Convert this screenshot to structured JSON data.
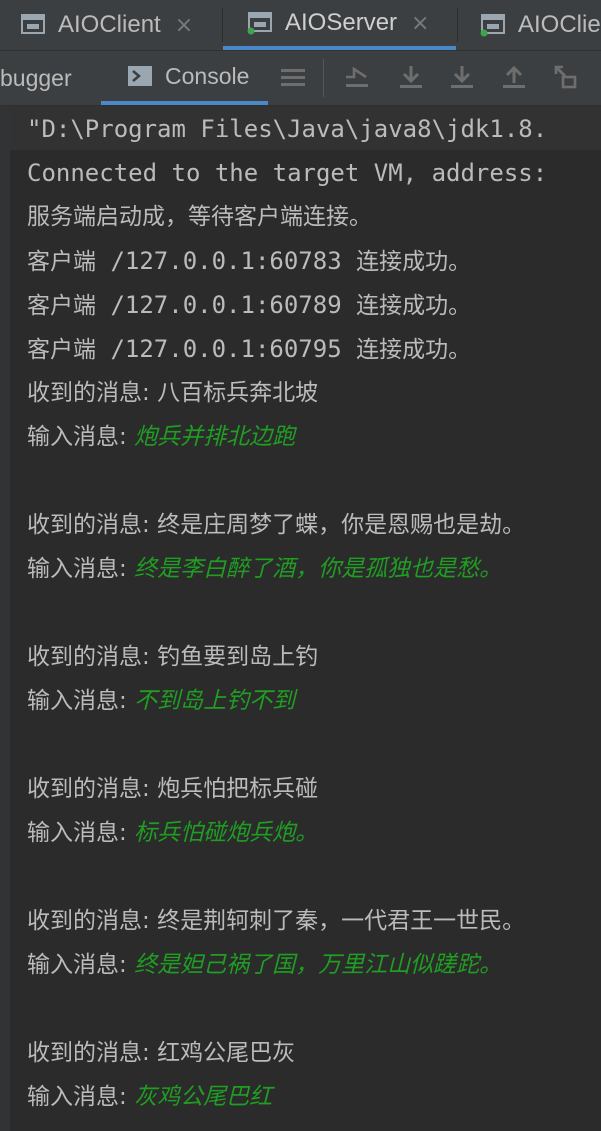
{
  "tabs": [
    {
      "label": "AIOClient",
      "closable": true
    },
    {
      "label": "AIOServer",
      "closable": true,
      "active": true
    },
    {
      "label": "AIOClie",
      "closable": false
    }
  ],
  "toolbar": {
    "debugger_label": "bugger",
    "console_label": "Console",
    "buttons": [
      "menu-icon",
      "restore-layout-icon",
      "step-over-icon",
      "step-into-icon",
      "step-out-icon",
      "run-to-cursor-icon"
    ]
  },
  "console": {
    "command": "\"D:\\Program Files\\Java\\java8\\jdk1.8.",
    "connected": "Connected to the target VM, address:",
    "server_started": "服务端启动成，等待客户端连接。",
    "clients": [
      {
        "prefix": "客户端",
        "address": " /127.0.0.1:60783 ",
        "status": "连接成功。"
      },
      {
        "prefix": "客户端",
        "address": " /127.0.0.1:60789 ",
        "status": "连接成功。"
      },
      {
        "prefix": "客户端",
        "address": " /127.0.0.1:60795 ",
        "status": "连接成功。"
      }
    ],
    "received_label": "收到的消息: ",
    "input_label": "输入消息: ",
    "exchanges": [
      {
        "received": "八百标兵奔北坡",
        "input": "炮兵并排北边跑"
      },
      {
        "received": "终是庄周梦了蝶，你是恩赐也是劫。",
        "input": "终是李白醉了酒，你是孤独也是愁。"
      },
      {
        "received": "钓鱼要到岛上钓",
        "input": "不到岛上钓不到"
      },
      {
        "received": "炮兵怕把标兵碰",
        "input": "标兵怕碰炮兵炮。"
      },
      {
        "received": "终是荆轲刺了秦，一代君王一世民。",
        "input": "终是妲己祸了国，万里江山似蹉跎。"
      },
      {
        "received": "红鸡公尾巴灰",
        "input": "灰鸡公尾巴红"
      }
    ]
  },
  "colors": {
    "background": "#2b2b2b",
    "text": "#bbbbbb",
    "user_input": "#1f9e22",
    "accent": "#4a88c7"
  }
}
